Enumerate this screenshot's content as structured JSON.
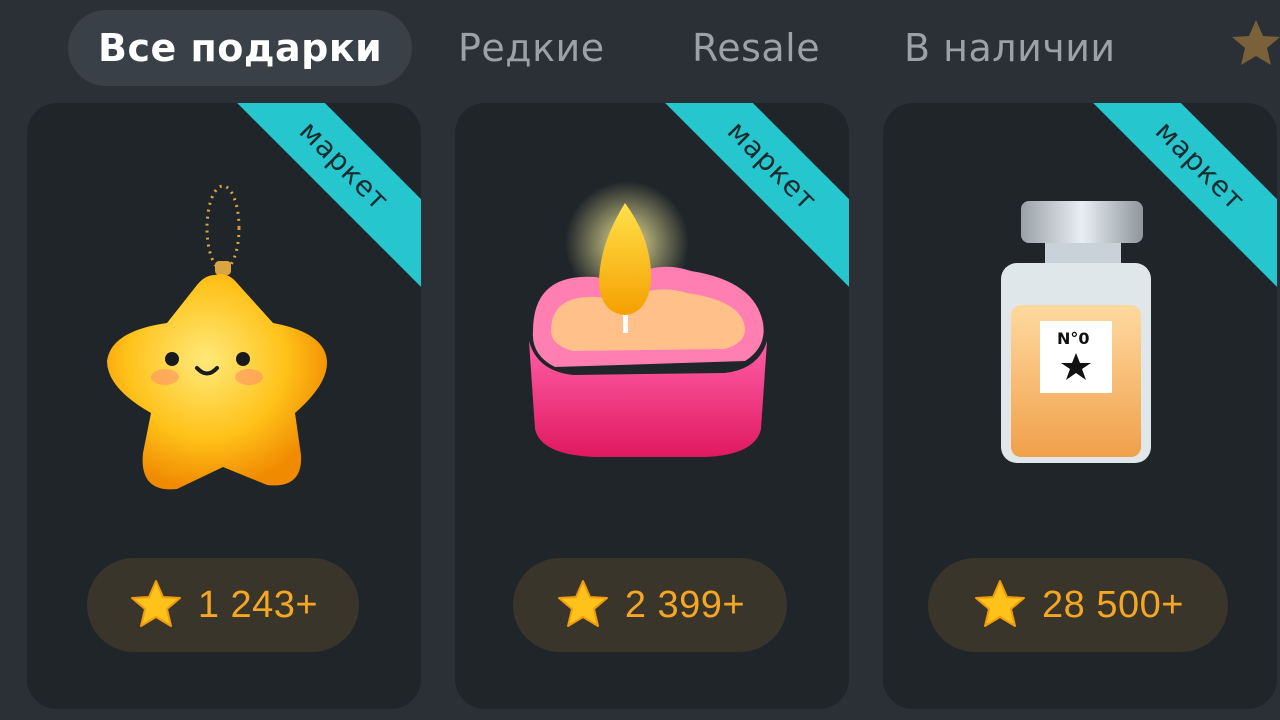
{
  "tabs": [
    {
      "label": "Все подарки",
      "active": true
    },
    {
      "label": "Редкие",
      "active": false
    },
    {
      "label": "Resale",
      "active": false
    },
    {
      "label": "В наличии",
      "active": false
    }
  ],
  "more_icon": "star-icon",
  "cards": [
    {
      "badge": "маркет",
      "item": "star-keychain",
      "price": "1 243+"
    },
    {
      "badge": "маркет",
      "item": "heart-candle",
      "price": "2 399+"
    },
    {
      "badge": "маркет",
      "item": "perfume-bottle",
      "price": "28 500+",
      "bottle_label": "N°0"
    }
  ],
  "colors": {
    "background": "#2a3036",
    "card": "#20252a",
    "badge": "#26c6cf",
    "price": "#f5a623"
  }
}
